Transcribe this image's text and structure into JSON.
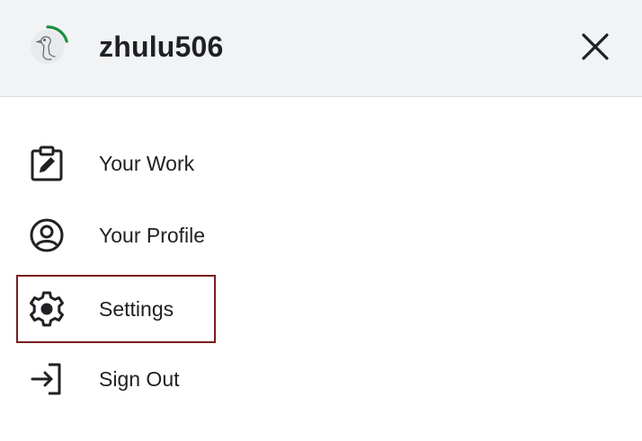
{
  "header": {
    "username": "zhulu506",
    "avatar_icon": "goose-avatar-icon",
    "progress_color": "#1e8e3e",
    "close_icon": "close-icon"
  },
  "menu": {
    "items": [
      {
        "label": "Your Work",
        "icon": "clipboard-edit-icon"
      },
      {
        "label": "Your Profile",
        "icon": "user-circle-icon"
      },
      {
        "label": "Settings",
        "icon": "gear-icon",
        "focused": true
      },
      {
        "label": "Sign Out",
        "icon": "sign-out-icon"
      }
    ]
  },
  "colors": {
    "header_bg": "#f1f3f4",
    "focus_outline": "#7a1e1e",
    "text": "#202124"
  }
}
